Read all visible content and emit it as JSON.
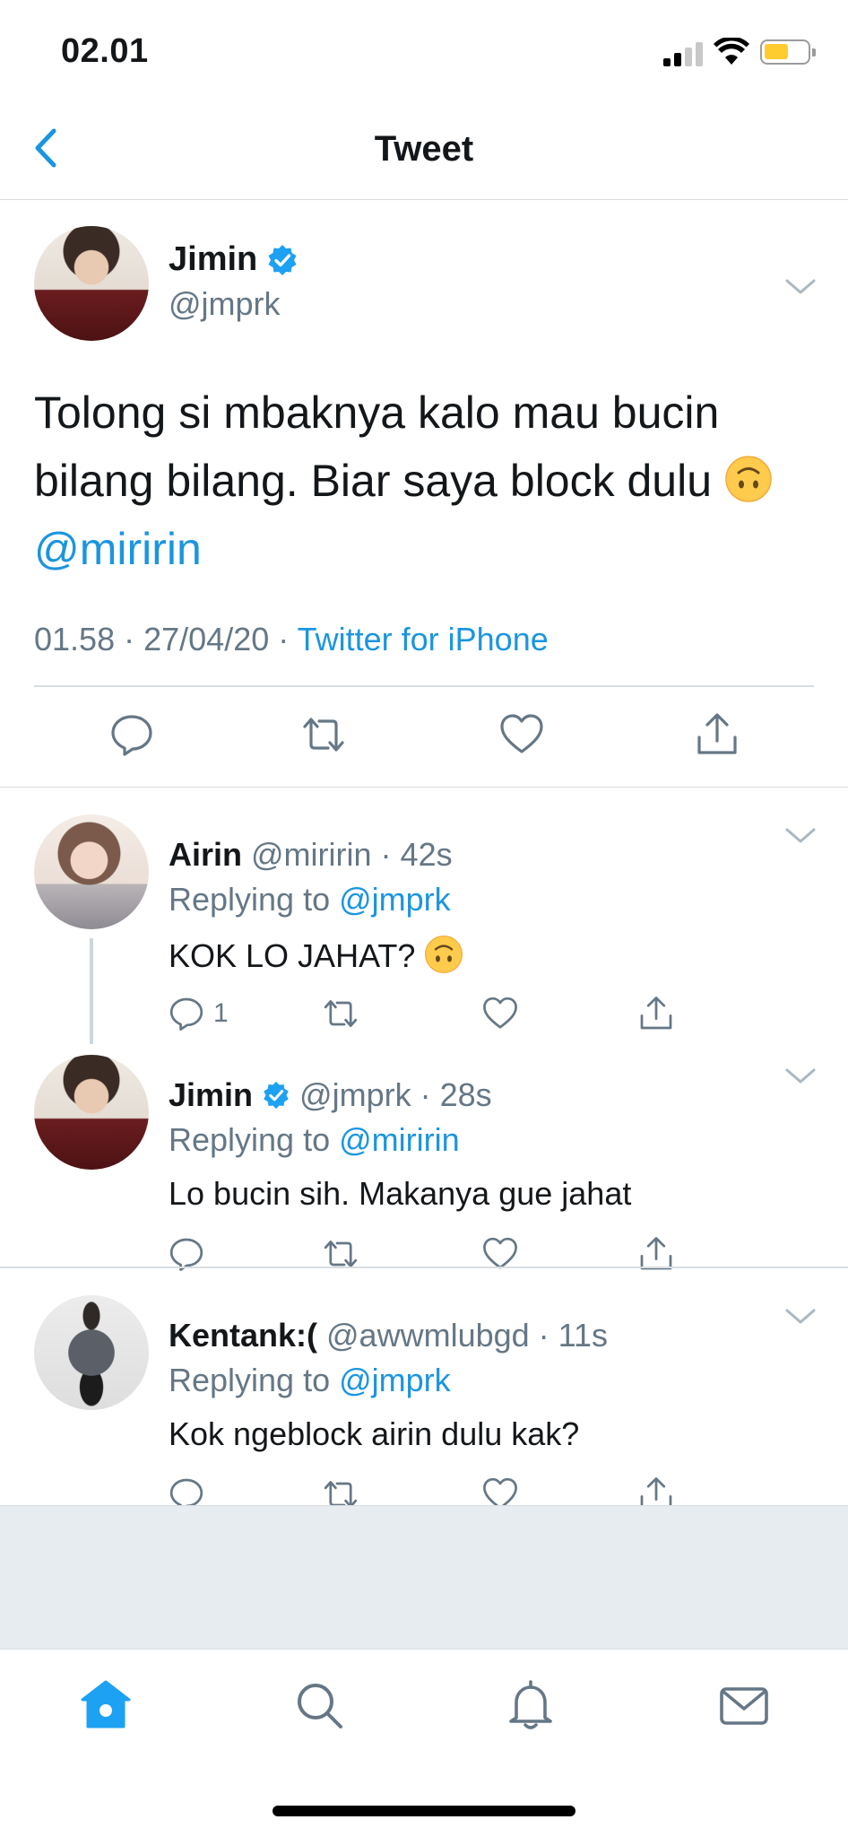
{
  "status_bar": {
    "time": "02.01"
  },
  "nav": {
    "title": "Tweet"
  },
  "main_tweet": {
    "name": "Jimin",
    "handle": "@jmprk",
    "text_line1": "Tolong si mbaknya kalo mau bucin",
    "text_line2": "bilang bilang. Biar saya block dulu",
    "mention": "@miririn",
    "time": "01.58",
    "date": "27/04/20",
    "source": "Twitter for iPhone"
  },
  "replies": [
    {
      "name": "Airin",
      "handle": "@miririn",
      "age": "42s",
      "replying_label": "Replying to",
      "replying_to": "@jmprk",
      "text": "KOK LO JAHAT?",
      "reply_count": "1"
    },
    {
      "name": "Jimin",
      "handle": "@jmprk",
      "age": "28s",
      "replying_label": "Replying to",
      "replying_to": "@miririn",
      "text": "Lo bucin sih. Makanya gue jahat"
    },
    {
      "name": "Kentank:(",
      "handle": "@awwmlubgd",
      "age": "11s",
      "replying_label": "Replying to",
      "replying_to": "@jmprk",
      "text": "Kok ngeblock airin dulu kak?"
    }
  ],
  "colors": {
    "accent": "#1b95e0",
    "secondary_text": "#657786",
    "divider": "#d9dde1",
    "background_fill": "#e6ecf0"
  },
  "icons": {
    "tabs": [
      "home-icon",
      "search-icon",
      "notifications-icon",
      "messages-icon"
    ],
    "actions": [
      "reply-icon",
      "retweet-icon",
      "like-icon",
      "share-icon"
    ]
  }
}
